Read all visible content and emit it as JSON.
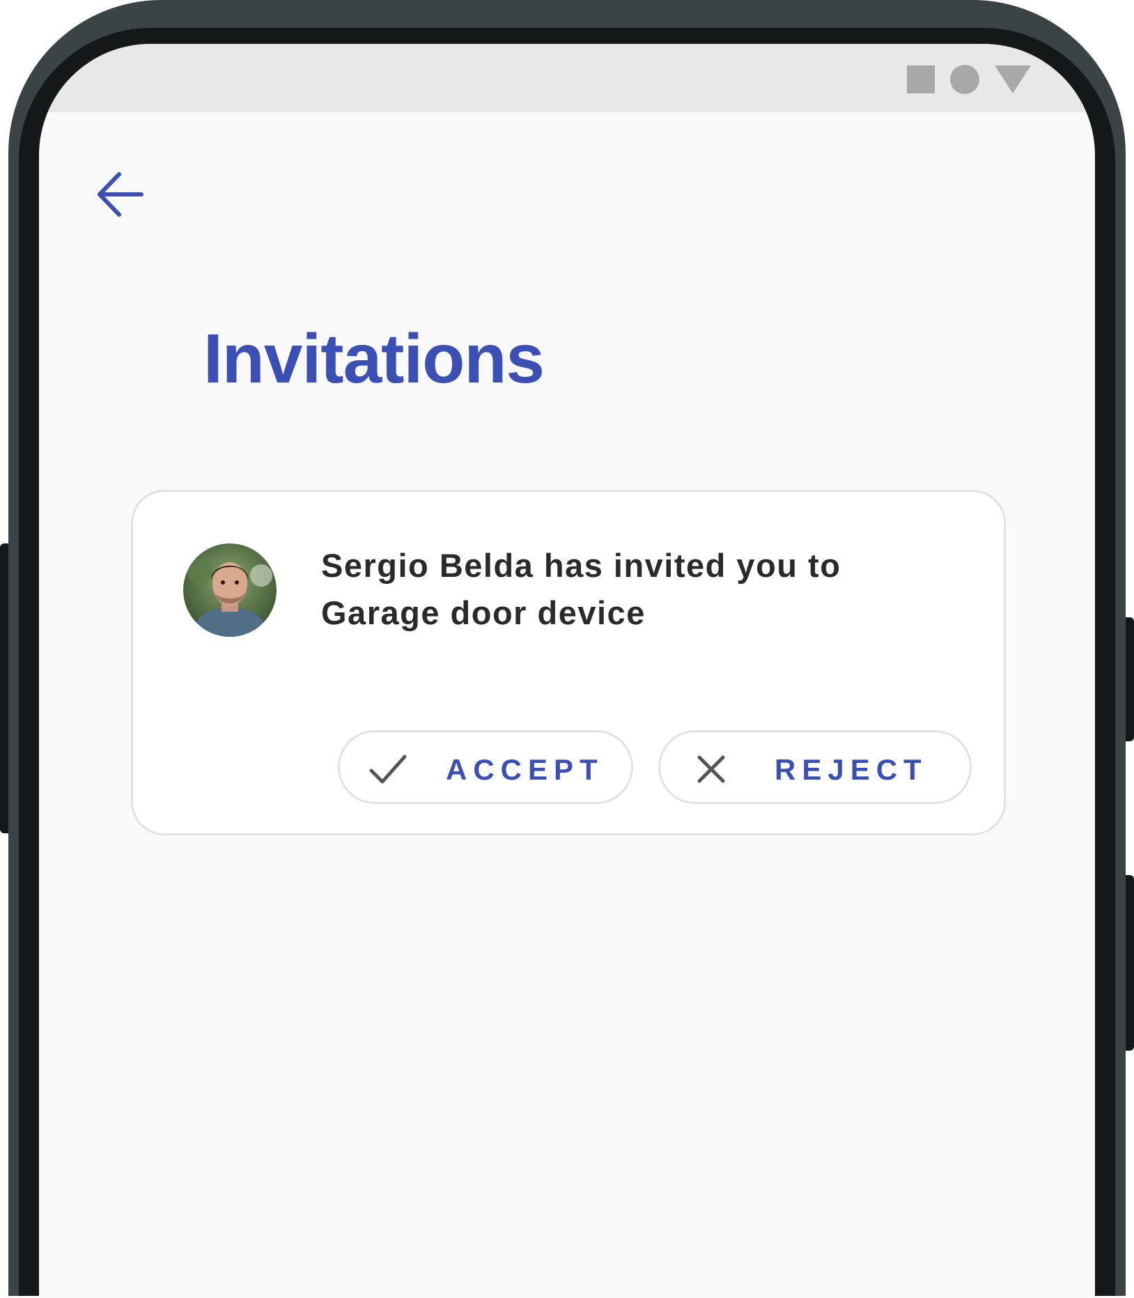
{
  "header": {
    "title": "Invitations",
    "back_icon": "arrow-left-icon"
  },
  "status_bar": {
    "icons": [
      "square-icon",
      "circle-icon",
      "triangle-icon"
    ]
  },
  "invitation": {
    "avatar_icon": "user-avatar",
    "message": "Sergio Belda has invited you to Garage door device",
    "accept": {
      "label": "ACCEPT",
      "icon": "check-icon"
    },
    "reject": {
      "label": "REJECT",
      "icon": "close-icon"
    }
  },
  "colors": {
    "accent": "#3b4fb5",
    "text": "#2a2a2a",
    "screen_background": "#f9f9f9",
    "border": "#e2e2e2"
  }
}
